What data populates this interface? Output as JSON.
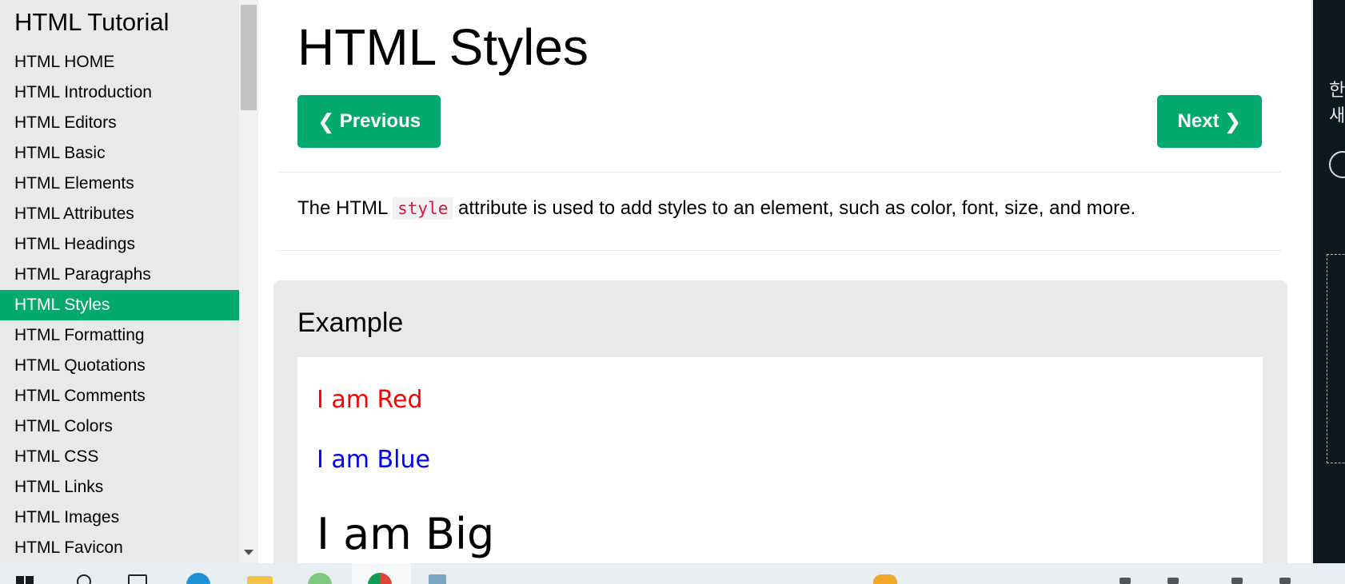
{
  "sidebar": {
    "title": "HTML Tutorial",
    "items": [
      {
        "label": "HTML HOME"
      },
      {
        "label": "HTML Introduction"
      },
      {
        "label": "HTML Editors"
      },
      {
        "label": "HTML Basic"
      },
      {
        "label": "HTML Elements"
      },
      {
        "label": "HTML Attributes"
      },
      {
        "label": "HTML Headings"
      },
      {
        "label": "HTML Paragraphs"
      },
      {
        "label": "HTML Styles",
        "active": true
      },
      {
        "label": "HTML Formatting"
      },
      {
        "label": "HTML Quotations"
      },
      {
        "label": "HTML Comments"
      },
      {
        "label": "HTML Colors"
      },
      {
        "label": "HTML CSS"
      },
      {
        "label": "HTML Links"
      },
      {
        "label": "HTML Images"
      },
      {
        "label": "HTML Favicon"
      }
    ]
  },
  "main": {
    "title": "HTML Styles",
    "prev_label": "Previous",
    "next_label": "Next",
    "prev_icon": "chevron-left-icon",
    "next_icon": "chevron-right-icon",
    "intro_before": "The HTML ",
    "intro_code": "style",
    "intro_after": " attribute is used to add styles to an element, such as color, font, size, and more.",
    "example": {
      "heading": "Example",
      "lines": [
        {
          "text": "I am Red",
          "color": "#FF0000"
        },
        {
          "text": "I am Blue",
          "color": "#0000FF"
        },
        {
          "text": "I am Big",
          "color": "#000000"
        }
      ]
    }
  },
  "right_panel": {
    "line1": "한",
    "line2": "새"
  },
  "colors": {
    "accent": "#04AA6D",
    "sidebar_bg": "#E7E9EB",
    "code_text": "#DC143C"
  },
  "taskbar": {
    "icons": [
      "windows-start-icon",
      "search-icon",
      "task-view-icon",
      "edge-icon",
      "file-explorer-icon",
      "app-icon",
      "chrome-icon",
      "notepad-icon",
      "coins-icon"
    ]
  }
}
